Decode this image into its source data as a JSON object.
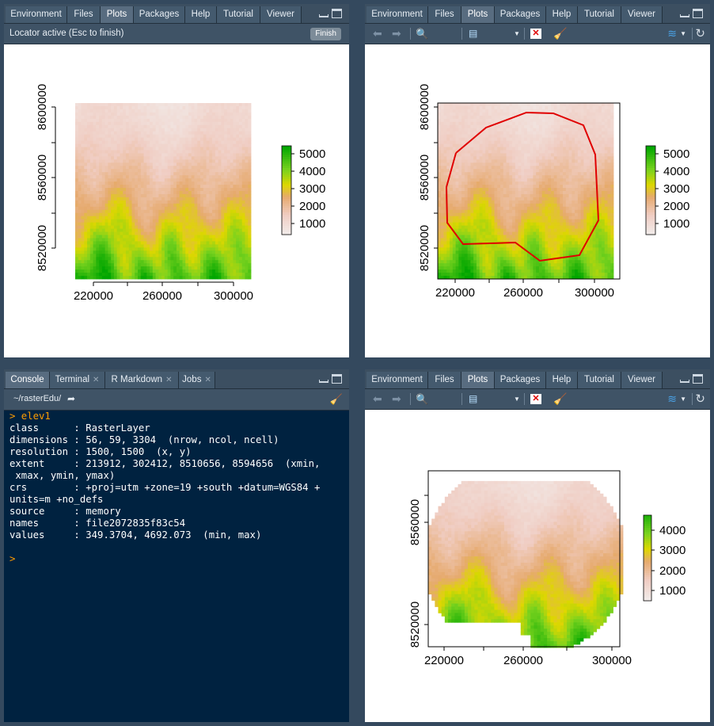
{
  "panes": {
    "topLeft": {
      "tabs": [
        "Environment",
        "Files",
        "Plots",
        "Packages",
        "Help",
        "Tutorial",
        "Viewer"
      ],
      "active": "Plots",
      "locator_text": "Locator active (Esc to finish)",
      "finish_label": "Finish"
    },
    "topRight": {
      "tabs": [
        "Environment",
        "Files",
        "Plots",
        "Packages",
        "Help",
        "Tutorial",
        "Viewer"
      ],
      "active": "Plots",
      "zoom_label": "Zoom",
      "export_label": "Export"
    },
    "bottomRight": {
      "tabs": [
        "Environment",
        "Files",
        "Plots",
        "Packages",
        "Help",
        "Tutorial",
        "Viewer"
      ],
      "active": "Plots",
      "zoom_label": "Zoom",
      "export_label": "Export"
    },
    "console": {
      "tabs": [
        "Console",
        "Terminal",
        "R Markdown",
        "Jobs"
      ],
      "active": "Console",
      "path": "~/rasterEdu/",
      "lines": [
        {
          "t": "> elev1",
          "prompt": true
        },
        {
          "t": "class      : RasterLayer"
        },
        {
          "t": "dimensions : 56, 59, 3304  (nrow, ncol, ncell)"
        },
        {
          "t": "resolution : 1500, 1500  (x, y)"
        },
        {
          "t": "extent     : 213912, 302412, 8510656, 8594656  (xmin,"
        },
        {
          "t": " xmax, ymin, ymax)"
        },
        {
          "t": "crs        : +proj=utm +zone=19 +south +datum=WGS84 +"
        },
        {
          "t": "units=m +no_defs"
        },
        {
          "t": "source     : memory"
        },
        {
          "t": "names      : file2072835f83c54"
        },
        {
          "t": "values     : 349.3704, 4692.073  (min, max)"
        },
        {
          "t": ""
        },
        {
          "t": ">",
          "prompt": true
        }
      ]
    }
  },
  "plots": {
    "full": {
      "xticks": [
        "220000",
        "260000",
        "300000"
      ],
      "yticks": [
        "8520000",
        "8560000",
        "8600000"
      ],
      "legend": [
        "5000",
        "4000",
        "3000",
        "2000",
        "1000"
      ]
    },
    "masked": {
      "xticks": [
        "220000",
        "260000",
        "300000"
      ],
      "yticks": [
        "8520000",
        "8560000"
      ],
      "legend": [
        "4000",
        "3000",
        "2000",
        "1000"
      ]
    }
  },
  "colors": {
    "low": "#f2f2f2",
    "pink": "#f0c9c0",
    "tan": "#e6a86a",
    "yellow": "#d9d400",
    "green": "#5ccc1a",
    "dark_green": "#00a600",
    "polygon": "#e00000"
  }
}
